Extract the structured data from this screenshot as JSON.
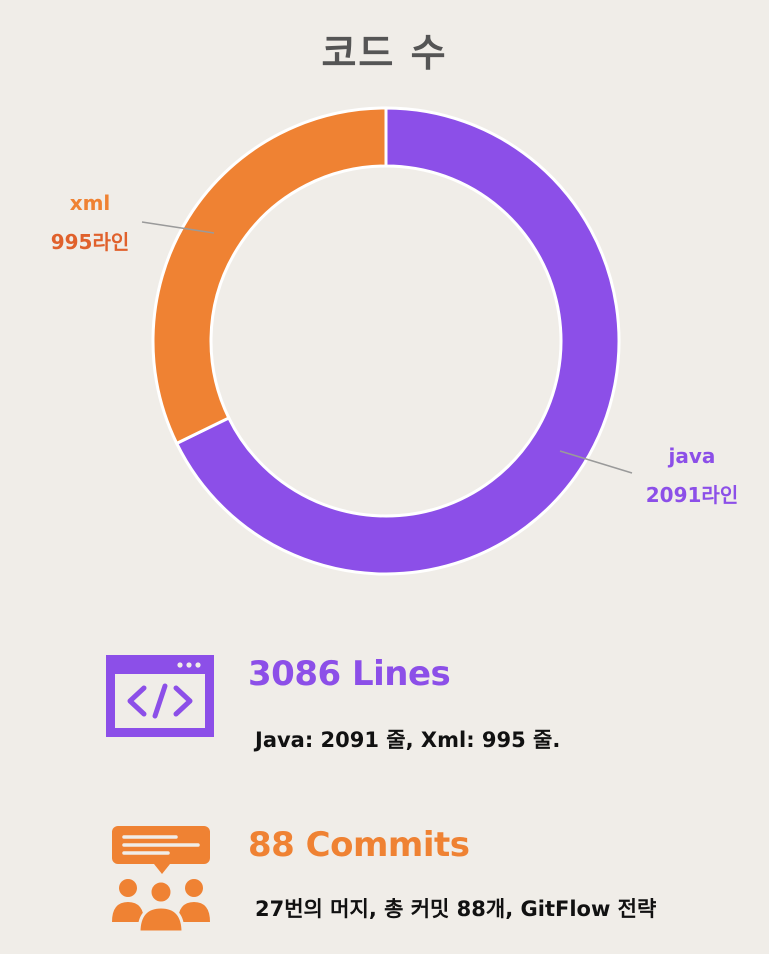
{
  "chart_data": {
    "type": "pie",
    "title": "코드 수",
    "categories": [
      "java",
      "xml"
    ],
    "values": [
      2091,
      995
    ],
    "value_labels": [
      "2091라인",
      "995라인"
    ],
    "colors": [
      "#8c4fe8",
      "#ef8233"
    ]
  },
  "stats": [
    {
      "title": "3086 Lines",
      "description": "Java: 2091 줄, Xml: 995 줄.",
      "color": "#8c4fe8",
      "icon": "code-window-icon"
    },
    {
      "title": "88 Commits",
      "description": "27번의 머지, 총 커밋 88개, GitFlow 전략",
      "color": "#ef8233",
      "icon": "team-chat-icon"
    }
  ]
}
